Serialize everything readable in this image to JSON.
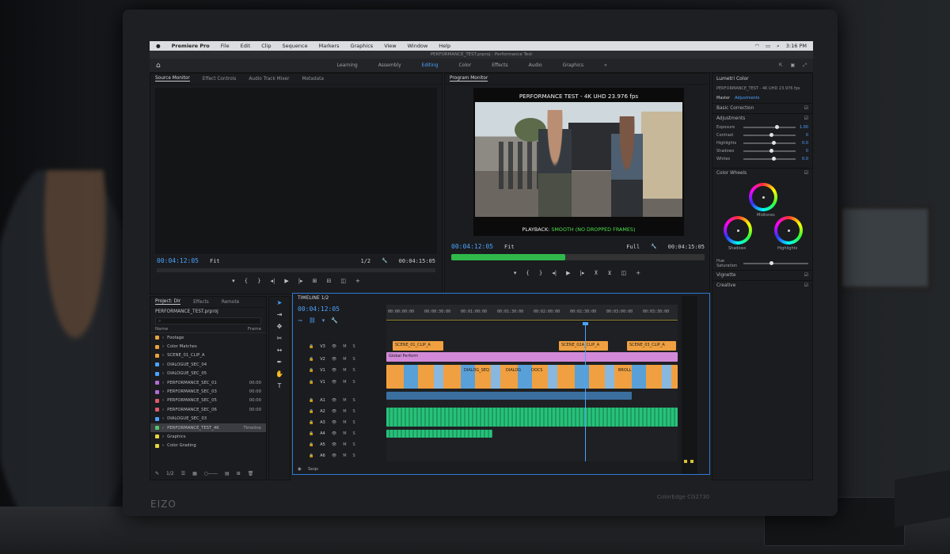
{
  "menubar": {
    "app": "Premiere Pro",
    "items": [
      "File",
      "Edit",
      "Clip",
      "Sequence",
      "Markers",
      "Graphics",
      "View",
      "Window",
      "Help"
    ],
    "clock": "3:16 PM"
  },
  "title_bar": "PERFORMANCE_TEST.prproj - Performance Test",
  "workspaces": {
    "tabs": [
      "Learning",
      "Assembly",
      "Editing",
      "Color",
      "Effects",
      "Audio",
      "Graphics",
      "Libraries"
    ],
    "active": "Editing"
  },
  "source_panel": {
    "tabs": [
      "Source Monitor",
      "Effect Controls",
      "Audio Track Mixer",
      "Metadata"
    ],
    "timecode_in": "00:04:12:05",
    "fit": "Fit",
    "quality": "1/2",
    "timecode_out": "00:04:15:05"
  },
  "program_panel": {
    "title": "Program Monitor",
    "frame_title": "PERFORMANCE TEST - 4K UHD 23.976 fps",
    "playback_prefix": "PLAYBACK: ",
    "playback_status": "SMOOTH (NO DROPPED FRAMES)",
    "timecode_in": "00:04:12:05",
    "fit": "Fit",
    "quality": "Full",
    "timecode_out": "00:04:15:05",
    "progress": 0.45
  },
  "lumetri": {
    "title": "Lumetri Color",
    "clip": "PERFORMANCE_TEST - 4K UHD 23.976 fps",
    "preset_label": "Master",
    "preset_value": "Adjustments",
    "basic": "Basic Correction",
    "adjustments_title": "Adjustments",
    "sliders": [
      {
        "label": "Exposure",
        "value": "1.00",
        "pos": 0.6
      },
      {
        "label": "Contrast",
        "value": "0",
        "pos": 0.5
      },
      {
        "label": "Highlights",
        "value": "0.0",
        "pos": 0.55
      },
      {
        "label": "Shadows",
        "value": "0",
        "pos": 0.5
      },
      {
        "label": "Whites",
        "value": "0.0",
        "pos": 0.55
      }
    ],
    "wheels_title": "Color Wheels",
    "wheels": [
      "Midtones",
      "Shadows",
      "Highlights"
    ],
    "hsl_label": "Hue Saturation",
    "vignette": "Vignette",
    "hsl2": "Creative"
  },
  "project_panel": {
    "tabs": [
      "Project: Dir",
      "Effects",
      "Remote"
    ],
    "project_name": "PERFORMANCE_TEST.prproj",
    "search_placeholder": "",
    "col_name": "Name",
    "col_dur": "Frame",
    "items": [
      {
        "name": "Footage",
        "dur": "",
        "color": "#e8a33d"
      },
      {
        "name": "Color Matches",
        "dur": "",
        "color": "#e8a33d"
      },
      {
        "name": "SCENE_01_CLIP_A",
        "dur": "",
        "color": "#e8a33d"
      },
      {
        "name": "DIALOGUE_SEC_04",
        "dur": "",
        "color": "#4aa3ff"
      },
      {
        "name": "DIALOGUE_SEC_05",
        "dur": "",
        "color": "#4aa3ff"
      },
      {
        "name": "PERFORMANCE_SEC_01",
        "dur": "00:00",
        "color": "#b56ad6"
      },
      {
        "name": "PERFORMANCE_SEC_03",
        "dur": "00:00",
        "color": "#b56ad6"
      },
      {
        "name": "PERFORMANCE_SEC_05",
        "dur": "00:00",
        "color": "#e05a6a"
      },
      {
        "name": "PERFORMANCE_SEC_06",
        "dur": "00:00",
        "color": "#e05a6a"
      },
      {
        "name": "DIALOGUE_SEC_03",
        "dur": "",
        "color": "#4aa3ff"
      },
      {
        "name": "PERFORMANCE_TEST_4K",
        "dur": "Timeline",
        "color": "#58c86a"
      },
      {
        "name": "Graphics",
        "dur": "",
        "color": "#e8d43d"
      },
      {
        "name": "Color Grading",
        "dur": "",
        "color": "#e8d43d"
      }
    ],
    "zoom": "1/2"
  },
  "timeline": {
    "tab": "TIMELINE 1/2",
    "timecode": "00:04:12:05",
    "ruler": [
      "00:00:00:00",
      "00:00:30:00",
      "00:01:00:00",
      "00:01:30:00",
      "00:02:00:00",
      "00:02:30:00",
      "00:03:00:00",
      "00:03:30:00"
    ],
    "video_tracks": [
      {
        "name": "V3"
      },
      {
        "name": "V2"
      },
      {
        "name": "V1"
      },
      {
        "name": "V1"
      }
    ],
    "audio_tracks": [
      {
        "name": "A1"
      },
      {
        "name": "A2"
      },
      {
        "name": "A3"
      },
      {
        "name": "A4"
      },
      {
        "name": "A5"
      },
      {
        "name": "A6"
      }
    ],
    "clips": {
      "v3a": "SCENE_01_CLIP_A",
      "v3b": "SCENE_02A_CLIP_A",
      "v3c": "SCENE_03_CLIP_A",
      "v2": "Global Perform",
      "v1a": "DIALOG_SEQ",
      "v1b": "DIALOG",
      "v1c": "DOCS",
      "v1d": "BROLL"
    },
    "footer": "Seqs"
  },
  "colors": {
    "accent": "#4aa3ff",
    "playback_ok": "#4ee04a",
    "audio": "#26c27a",
    "pink": "#d28ad8",
    "orange": "#f0a040"
  },
  "hardware": {
    "brand": "EIZO",
    "model": "ColorEdge CG2730"
  }
}
